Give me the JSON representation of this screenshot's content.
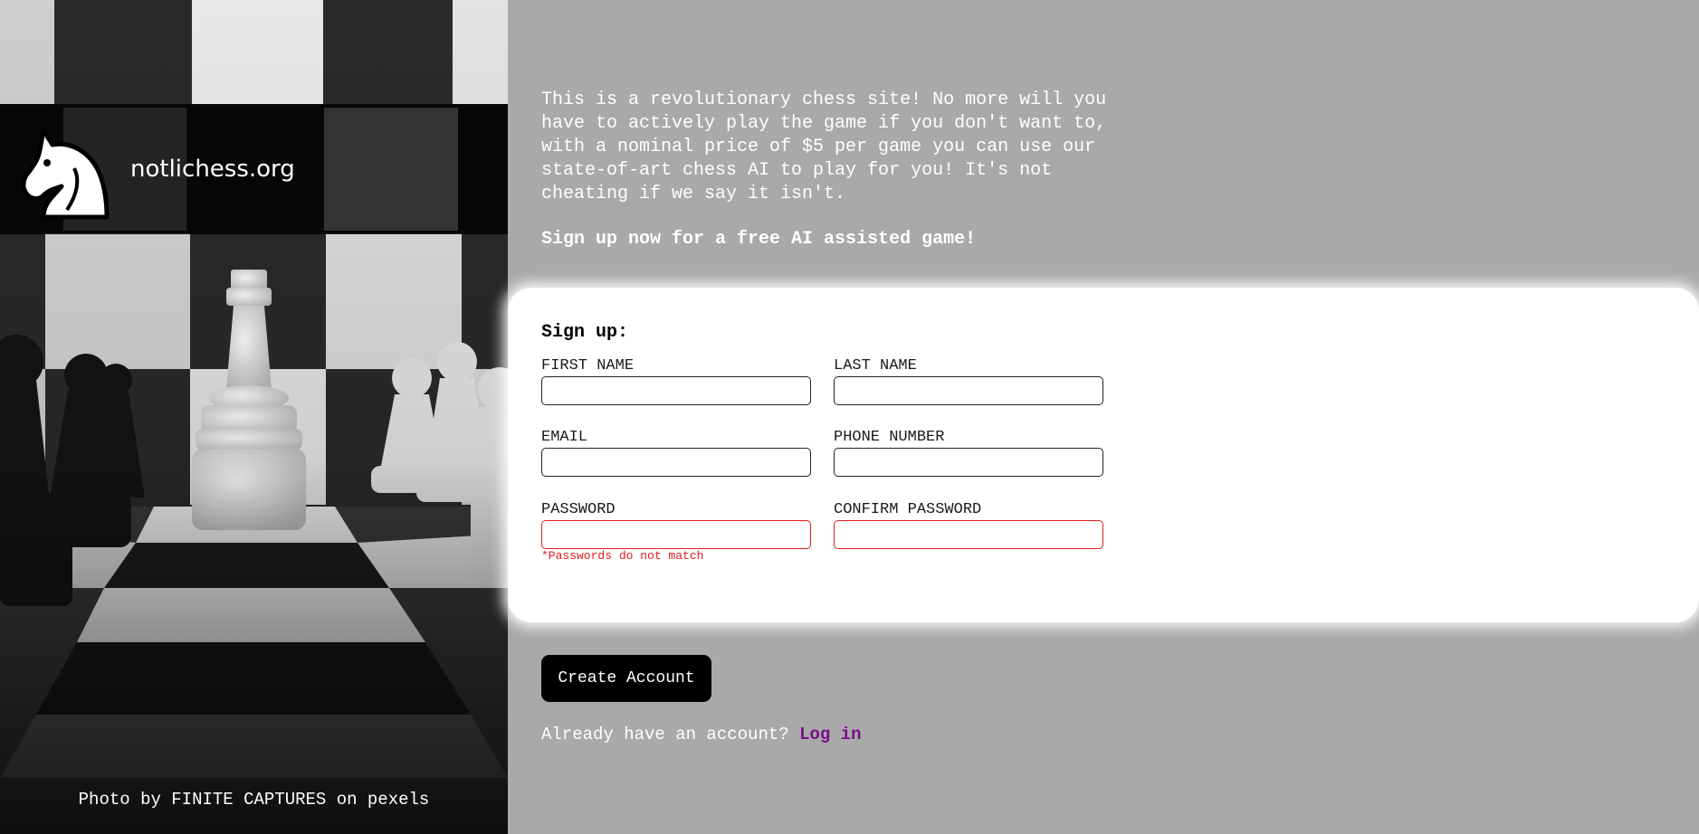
{
  "brand": {
    "name": "notlichess.org",
    "logo_icon": "chess-knight-icon"
  },
  "hero": {
    "photo_credit": "Photo by FINITE CAPTURES on pexels"
  },
  "intro": {
    "text": "This is a revolutionary chess site! No more will you\nhave to actively play the game if you don't want to,\nwith a nominal price of $5 per game you can use our\nstate-of-art chess AI to play for you! It's not\ncheating if we say it isn't.",
    "cta": "Sign up now for a free AI assisted game!"
  },
  "form": {
    "title": "Sign up:",
    "fields": {
      "first_name": {
        "label": "FIRST NAME",
        "value": ""
      },
      "last_name": {
        "label": "LAST NAME",
        "value": ""
      },
      "email": {
        "label": "EMAIL",
        "value": ""
      },
      "phone": {
        "label": "PHONE NUMBER",
        "value": ""
      },
      "password": {
        "label": "PASSWORD",
        "value": ""
      },
      "confirm_password": {
        "label": "CONFIRM PASSWORD",
        "value": ""
      }
    },
    "error_message": "*Passwords do not match",
    "submit_label": "Create Account"
  },
  "login": {
    "prompt": "Already have an account?",
    "link_label": "Log in"
  },
  "colors": {
    "page_background": "#a9a9a9",
    "card_background": "#ffffff",
    "error": "#e31b1b",
    "link": "#7a0f8a",
    "button": "#000000"
  }
}
